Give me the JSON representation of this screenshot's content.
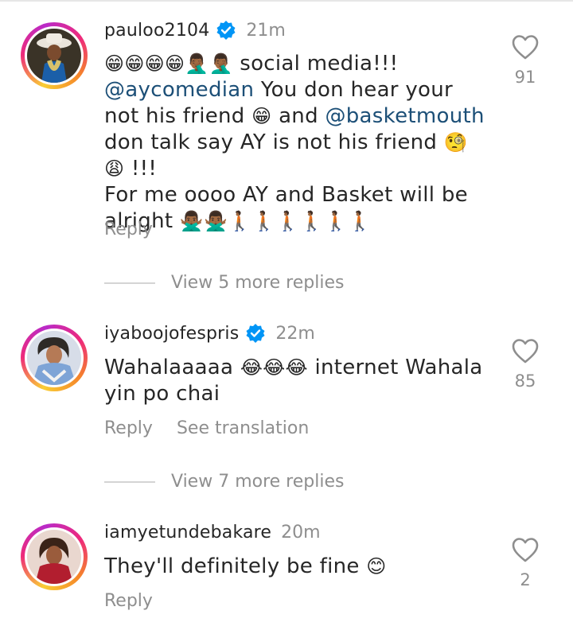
{
  "comments": [
    {
      "username": "pauloo2104",
      "verified": true,
      "time": "21m",
      "text_parts": {
        "line1_emojis": "😁😁😁😁🤦🏾‍♂️🤦🏾‍♂️",
        "line1_text": " social media!!!",
        "mention1": "@aycomedian",
        "line2_text": " You don hear your not his friend ",
        "emoji_grin": "😁",
        "and_text": " and ",
        "mention2": "@basketmouth",
        "line3_text": " don talk say AY is not his friend ",
        "emoji_faces": "🧐😩",
        "bang": " !!!",
        "line4_text": "For me oooo AY and Basket will be alright ",
        "emoji_tail": "🙅🏾‍♂️🙅🏾‍♂️🚶🏾🚶🏾🚶🏾🚶🏾🚶🏾🚶🏾"
      },
      "likes": "91",
      "reply_label": "Reply",
      "view_replies": "View 5 more replies"
    },
    {
      "username": "iyaboojofespris",
      "verified": true,
      "time": "22m",
      "text_parts": {
        "word": "Wahalaaaaa ",
        "emojis": "😂😂😂",
        "rest": " internet Wahala yin po chai"
      },
      "likes": "85",
      "reply_label": "Reply",
      "translation_label": "See translation",
      "view_replies": "View 7 more replies"
    },
    {
      "username": "iamyetundebakare",
      "verified": false,
      "time": "20m",
      "text_parts": {
        "text": "They'll definitely be fine ",
        "emoji": "😊"
      },
      "likes": "2",
      "reply_label": "Reply"
    }
  ],
  "colors": {
    "mention": "#1c4f77",
    "verified_badge": "#0095f6",
    "muted_text": "#8e8e8e"
  },
  "icons": {
    "like": "heart-outline-icon",
    "verified": "verified-badge-icon"
  }
}
